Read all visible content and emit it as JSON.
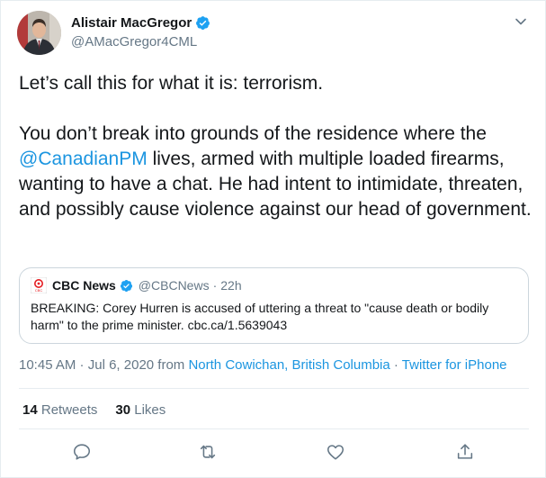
{
  "author": {
    "display_name": "Alistair MacGregor",
    "handle": "@AMacGregor4CML",
    "avatar_icon": "profile-photo",
    "verified_icon": "verified-badge-icon"
  },
  "tweet": {
    "para1": "Let’s call this for what it is: terrorism.",
    "para2_before": "You don’t break into grounds of the residence where the ",
    "para2_mention": "@CanadianPM",
    "para2_after": " lives, armed with multiple loaded firearms, wanting to have a chat. He had intent to intimidate, threaten, and possibly cause violence against our head of government."
  },
  "quoted": {
    "name": "CBC News",
    "handle": "@CBCNews",
    "separator": "·",
    "time": "22h",
    "text": "BREAKING: Corey Hurren is accused of uttering a threat to \"cause death or bodily harm\" to the prime minister. cbc.ca/1.5639043",
    "logo_label": "CBC"
  },
  "meta": {
    "time": "10:45 AM",
    "date_sep": " · ",
    "date": "Jul 6, 2020",
    "from": " from ",
    "location": "North Cowichan, British Columbia",
    "source_sep": " · ",
    "source": "Twitter for iPhone"
  },
  "stats": {
    "retweets_count": "14",
    "retweets_label": " Retweets",
    "likes_count": "30",
    "likes_label": " Likes"
  },
  "colors": {
    "link": "#1b95e0",
    "secondary": "#657786",
    "border": "#e6ecf0",
    "text": "#14171a"
  },
  "icons": [
    "chevron-down-icon",
    "reply-icon",
    "retweet-icon",
    "like-icon",
    "share-icon"
  ]
}
